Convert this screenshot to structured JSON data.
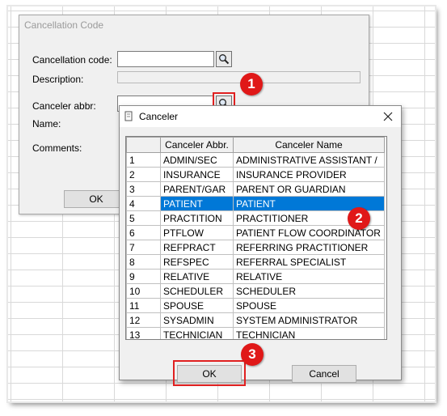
{
  "cancellation_window": {
    "title": "Cancellation Code",
    "code_label": "Cancellation code:",
    "code_value": "",
    "description_label": "Description:",
    "description_value": "",
    "canceler_abbr_label": "Canceler abbr:",
    "canceler_abbr_value": "",
    "name_label": "Name:",
    "comments_label": "Comments:",
    "ok_label": "OK"
  },
  "canceler_dialog": {
    "title": "Canceler",
    "columns": [
      "",
      "Canceler Abbr.",
      "Canceler Name"
    ],
    "rows": [
      {
        "num": "1",
        "abbr": "ADMIN/SEC",
        "name": "ADMINISTRATIVE ASSISTANT /"
      },
      {
        "num": "2",
        "abbr": "INSURANCE",
        "name": "INSURANCE PROVIDER"
      },
      {
        "num": "3",
        "abbr": "PARENT/GAR",
        "name": "PARENT OR GUARDIAN"
      },
      {
        "num": "4",
        "abbr": "PATIENT",
        "name": "PATIENT"
      },
      {
        "num": "5",
        "abbr": "PRACTITION",
        "name": "PRACTITIONER"
      },
      {
        "num": "6",
        "abbr": "PTFLOW",
        "name": "PATIENT FLOW COORDINATOR"
      },
      {
        "num": "7",
        "abbr": "REFPRACT",
        "name": "REFERRING PRACTITIONER"
      },
      {
        "num": "8",
        "abbr": "REFSPEC",
        "name": "REFERRAL SPECIALIST"
      },
      {
        "num": "9",
        "abbr": "RELATIVE",
        "name": "RELATIVE"
      },
      {
        "num": "10",
        "abbr": "SCHEDULER",
        "name": "SCHEDULER"
      },
      {
        "num": "11",
        "abbr": "SPOUSE",
        "name": "SPOUSE"
      },
      {
        "num": "12",
        "abbr": "SYSADMIN",
        "name": "SYSTEM ADMINISTRATOR"
      },
      {
        "num": "13",
        "abbr": "TECHNICIAN",
        "name": "TECHNICIAN"
      }
    ],
    "selected_row": 3,
    "ok_label": "OK",
    "cancel_label": "Cancel"
  },
  "callouts": [
    "1",
    "2",
    "3"
  ],
  "colors": {
    "highlight": "#0078d7",
    "callout_red": "#e01818"
  },
  "icons": {
    "search": "magnifier-icon",
    "close": "close-icon",
    "dialog": "dialog-app-icon"
  }
}
